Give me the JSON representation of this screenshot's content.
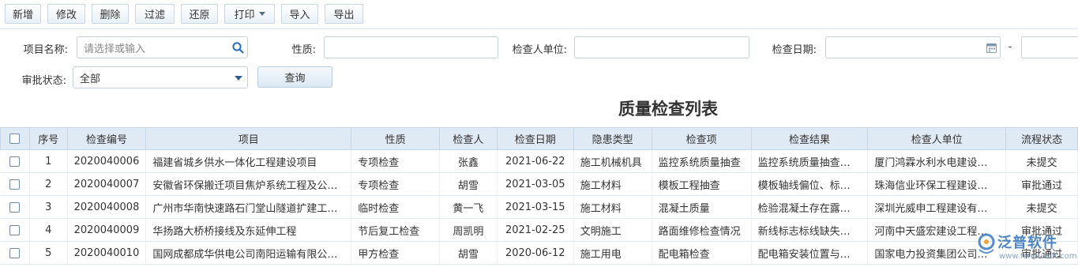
{
  "toolbar": {
    "add": "新增",
    "edit": "修改",
    "delete": "删除",
    "filter": "过滤",
    "restore": "还原",
    "print": "打印",
    "import": "导入",
    "export": "导出"
  },
  "filters": {
    "project_label": "项目名称:",
    "project_placeholder": "请选择或输入",
    "nature_label": "性质:",
    "unit_label": "检查人单位:",
    "date_label": "检查日期:",
    "date_sep": "-",
    "status_label": "审批状态:",
    "status_value": "全部",
    "query_button": "查询"
  },
  "page_title": "质量检查列表",
  "table": {
    "headers": [
      "序号",
      "检查编号",
      "项目",
      "性质",
      "检查人",
      "检查日期",
      "隐患类型",
      "检查项",
      "检查结果",
      "检查人单位",
      "流程状态"
    ],
    "rows": [
      [
        "1",
        "2020040006",
        "福建省城乡供水一体化工程建设项目",
        "专项检查",
        "张鑫",
        "2021-06-22",
        "施工机械机具",
        "监控系统质量抽查",
        "监控系统质量抽查…",
        "厦门鸿霖水利水电建设…",
        "未提交"
      ],
      [
        "2",
        "2020040007",
        "安徽省环保搬迁项目焦炉系统工程及公…",
        "专项检查",
        "胡雪",
        "2021-03-05",
        "施工材料",
        "模板工程抽查",
        "模板轴线偏位、标…",
        "珠海信业环保工程建设…",
        "审批通过"
      ],
      [
        "3",
        "2020040008",
        "广州市华南快速路石门堂山隧道扩建工…",
        "临时检查",
        "黄一飞",
        "2021-03-15",
        "施工材料",
        "混凝土质量",
        "检验混凝土存在露…",
        "深圳光威申工程建设有…",
        "未提交"
      ],
      [
        "4",
        "2020040009",
        "华扬路大桥桥接线及东延伸工程",
        "节后复工检查",
        "周凯明",
        "2021-02-25",
        "文明施工",
        "路面维修检查情况",
        "新线标志标线缺失…",
        "河南中天盛宏建设工程…",
        "审批通过"
      ],
      [
        "5",
        "2020040010",
        "国网成都成华供电公司南阳运输有限公…",
        "甲方检查",
        "胡雪",
        "2020-06-12",
        "施工用电",
        "配电箱检查",
        "配电箱安装位置与…",
        "国家电力投资集团公司…",
        "审批通过"
      ]
    ]
  },
  "watermark": {
    "brand": "泛普软件",
    "url": "www.fanpusoft.com"
  },
  "colors": {
    "header_bg": "#dfeaf5",
    "link": "#2d6fb6",
    "pending": "#1a3fc0",
    "approved": "#3c8c26"
  }
}
